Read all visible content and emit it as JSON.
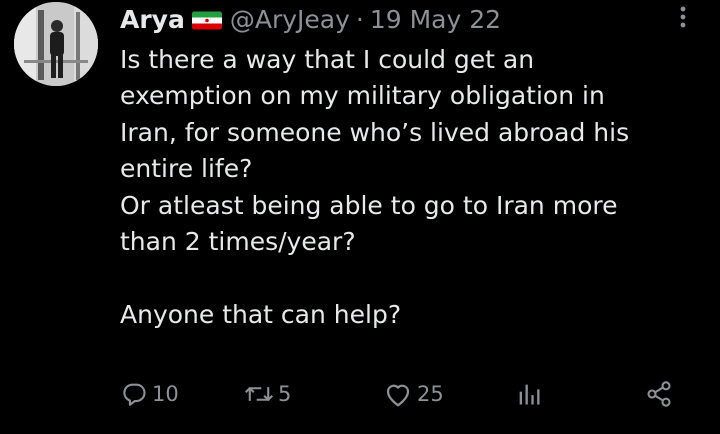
{
  "tweet": {
    "author_name": "Arya",
    "handle": "@AryJeay",
    "separator": "·",
    "date": "19 May 22",
    "text": "Is there a way that I could get an\nexemption on my military obligation in\nIran, for someone who’s lived abroad his\nentire life?\nOr atleast being able to go to Iran more\nthan 2 times/year?\n\nAnyone that can help?",
    "flag_icon": "iran-flag-icon"
  },
  "actions": {
    "replies": "10",
    "retweets": "5",
    "likes": "25",
    "views": "",
    "icons": {
      "reply": "reply-icon",
      "retweet": "retweet-icon",
      "like": "heart-icon",
      "views": "analytics-icon",
      "share": "share-icon",
      "more": "more-options-icon"
    }
  },
  "colors": {
    "background": "#000000",
    "text": "#e7e9ea",
    "secondary": "#8b9197",
    "flag_green": "#239f40",
    "flag_white": "#ffffff",
    "flag_red": "#da0000"
  }
}
